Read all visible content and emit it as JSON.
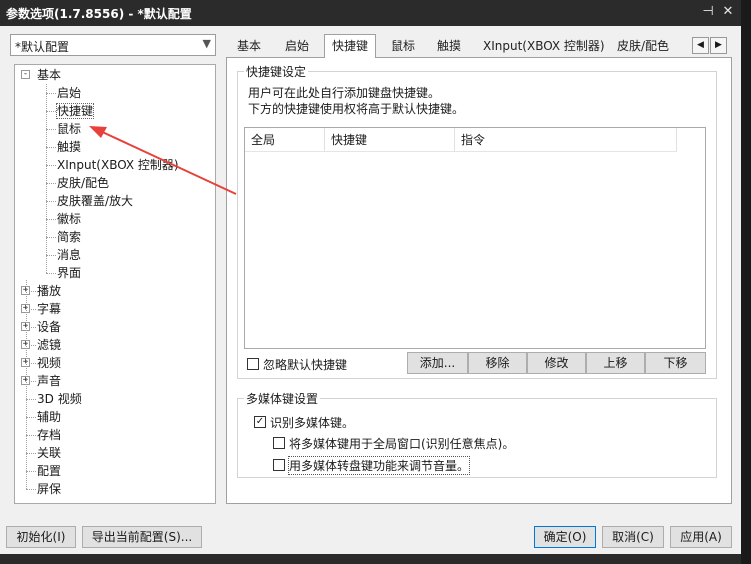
{
  "window": {
    "title": "参数选项(1.7.8556) - *默认配置",
    "pin_glyph": "⊣",
    "close_glyph": "✕"
  },
  "profile": {
    "value": "*默认配置"
  },
  "tree": {
    "root": "基本",
    "basic_children": [
      "启始",
      "快捷键",
      "鼠标",
      "触摸",
      "XInput(XBOX 控制器)",
      "皮肤/配色",
      "皮肤覆盖/放大",
      "徽标",
      "简索",
      "消息",
      "界面"
    ],
    "collapsed": [
      "播放",
      "字幕",
      "设备",
      "滤镜",
      "视频",
      "声音"
    ],
    "leaves": [
      "3D 视频",
      "辅助",
      "存档",
      "关联",
      "配置",
      "屏保"
    ]
  },
  "tabs": [
    "基本",
    "启始",
    "快捷键",
    "鼠标",
    "触摸",
    "XInput(XBOX 控制器)",
    "皮肤/配色"
  ],
  "shortcut": {
    "group_title": "快捷键设定",
    "desc1": "用户可在此处自行添加键盘快捷键。",
    "desc2": "下方的快捷键使用权将高于默认快捷键。",
    "columns": [
      "全局",
      "快捷键",
      "指令"
    ],
    "ignore_default_label": "忽略默认快捷键",
    "buttons": {
      "add": "添加...",
      "remove": "移除",
      "edit": "修改",
      "up": "上移",
      "down": "下移"
    }
  },
  "multimedia": {
    "group_title": "多媒体键设置",
    "recognize": "识别多媒体键。",
    "global_window": "将多媒体键用于全局窗口(识别任意焦点)。",
    "dial_volume": "用多媒体转盘键功能来调节音量。"
  },
  "footer": {
    "init": "初始化(I)",
    "export": "导出当前配置(S)...",
    "ok": "确定(O)",
    "cancel": "取消(C)",
    "apply": "应用(A)"
  },
  "icons": {
    "dropdown": "chevron-down-icon",
    "checkmark": "checkmark-icon",
    "tab_left": "chevron-left-icon",
    "tab_right": "chevron-right-icon"
  },
  "colors": {
    "titlebar": "#2b2b2b",
    "accent": "#0078d7",
    "annotation_arrow": "#e8403a"
  }
}
